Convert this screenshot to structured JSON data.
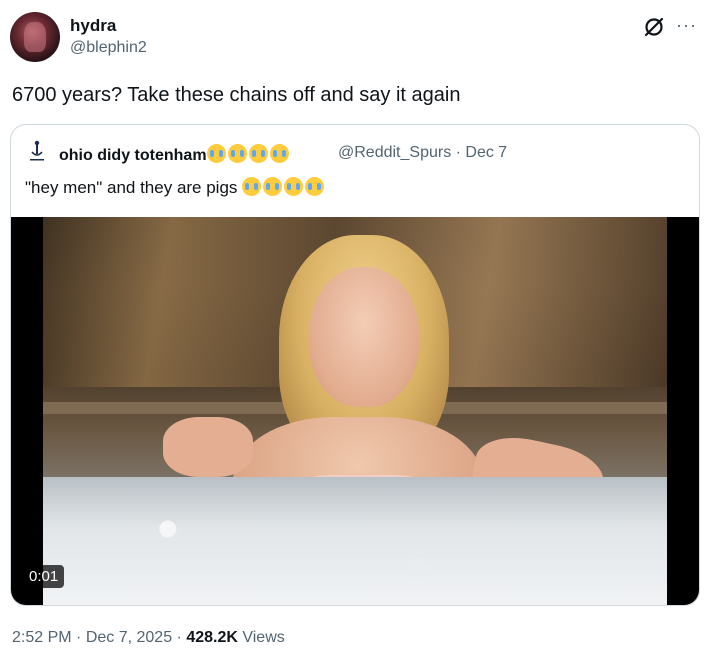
{
  "author": {
    "display_name": "hydra",
    "handle": "@blephin2"
  },
  "tweet": {
    "text": "6700 years? Take these chains off and say it again"
  },
  "quote": {
    "display_name": "ohio didy totenham",
    "name_emojis": [
      "loudly-crying-face",
      "loudly-crying-face",
      "loudly-crying-face",
      "crying-face"
    ],
    "handle_date": "@Reddit_Spurs · Dec 7",
    "text": "\"hey men\" and they are pigs",
    "text_emojis": [
      "loudly-crying-face",
      "loudly-crying-face",
      "loudly-crying-face",
      "loudly-crying-face"
    ],
    "video": {
      "duration": "0:01"
    }
  },
  "meta": {
    "time": "2:52 PM",
    "sep1": " · ",
    "date": "Dec 7, 2025",
    "sep2": " · ",
    "views": "428.2K",
    "views_label": " Views"
  },
  "icons": {
    "grok": "grok-icon",
    "more": "more-icon"
  },
  "colors": {
    "text": "#0f1419",
    "secondary": "#536471",
    "border": "#cfd9de"
  }
}
